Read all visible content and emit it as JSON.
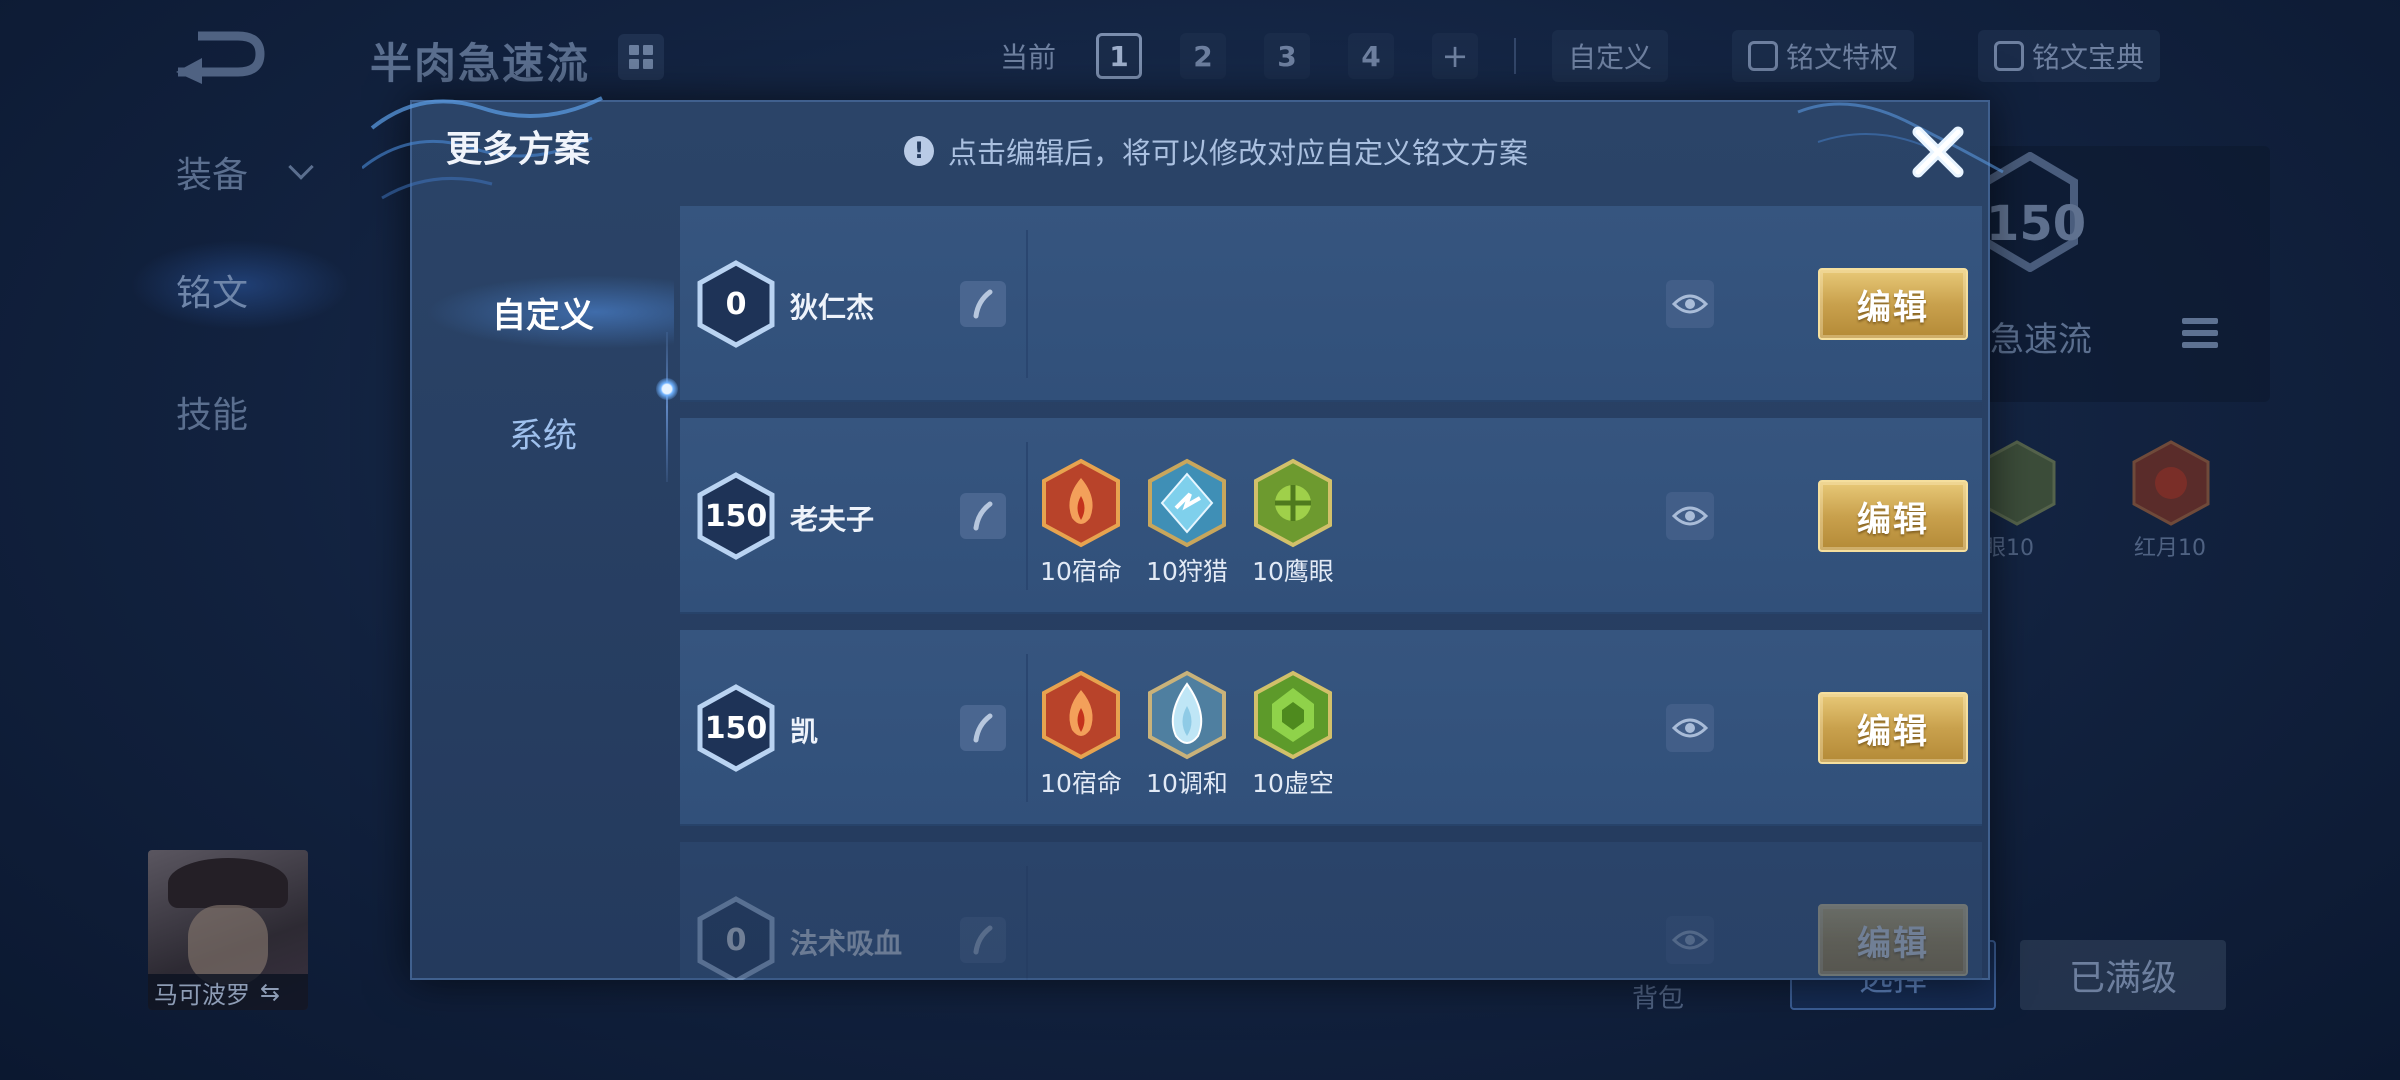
{
  "background": {
    "title": "半肉急速流",
    "current_label": "当前",
    "pages": [
      "1",
      "2",
      "3",
      "4"
    ],
    "add_label": "+",
    "custom_label": "自定义",
    "privilege_label": "铭文特权",
    "codex_label": "铭文宝典",
    "side": {
      "equip": "装备",
      "runes": "铭文",
      "skills": "技能"
    },
    "hero_name": "马可波罗",
    "badge_level": "150",
    "scheme_name_partial": "急速流",
    "rune_label_1": "眼10",
    "rune_label_2": "红月10",
    "bag_label": "背包",
    "select_label": "选择",
    "maxed_label": "已满级"
  },
  "modal": {
    "title": "更多方案",
    "notice": "点击编辑后，将可以修改对应自定义铭文方案",
    "tabs": {
      "custom": "自定义",
      "system": "系统"
    },
    "edit_label": "编辑",
    "rows": [
      {
        "level": "0",
        "name": "狄仁杰",
        "runes": []
      },
      {
        "level": "150",
        "name": "老夫子",
        "runes": [
          {
            "label": "10宿命",
            "color": "#c0452a"
          },
          {
            "label": "10狩猎",
            "color": "#4a9fc2"
          },
          {
            "label": "10鹰眼",
            "color": "#7fae3a"
          }
        ]
      },
      {
        "level": "150",
        "name": "凯",
        "runes": [
          {
            "label": "10宿命",
            "color": "#c0452a"
          },
          {
            "label": "10调和",
            "color": "#6fb7d8"
          },
          {
            "label": "10虚空",
            "color": "#6fae3a"
          }
        ]
      },
      {
        "level": "0",
        "name": "法术吸血",
        "runes": []
      }
    ]
  }
}
